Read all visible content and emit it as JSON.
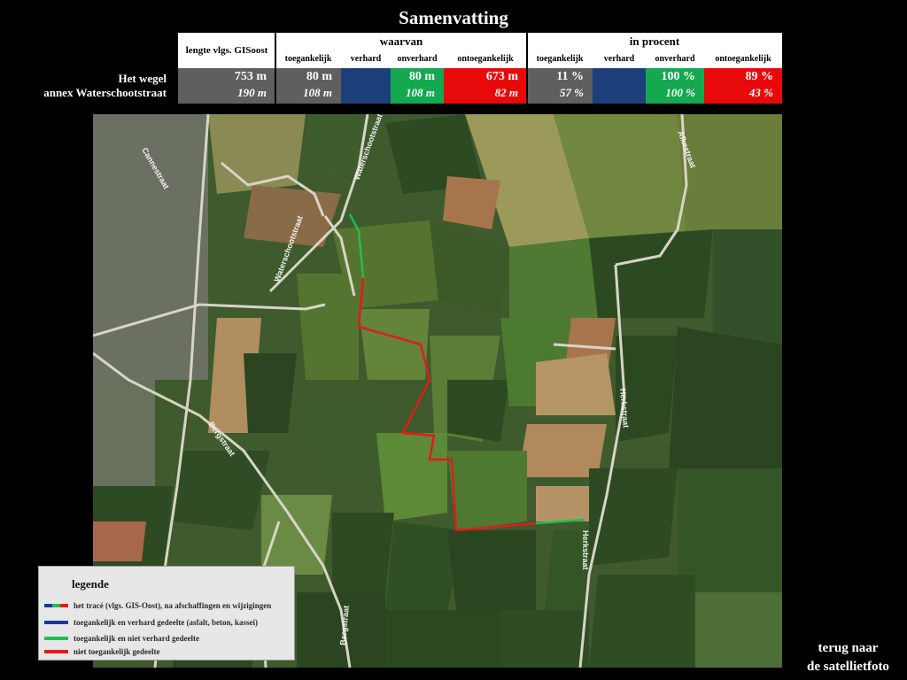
{
  "title": "Samenvatting",
  "road": {
    "line1": "Het wegel",
    "line2": "annex Waterschootstraat"
  },
  "table": {
    "length_header": "lengte vlgs. GISoost",
    "group_waarvan": "waarvan",
    "group_procent": "in procent",
    "sub_waarvan": [
      "toegankelijk",
      "verhard",
      "onverhard",
      "ontoegankelijk"
    ],
    "sub_procent": [
      "toegankelijk",
      "verhard",
      "onverhard",
      "ontoegankelijk"
    ],
    "row1": {
      "length": "753 m",
      "toegankelijk": "80 m",
      "verhard": "",
      "onverhard": "80 m",
      "ontoegankelijk": "673 m",
      "pct_toegankelijk": "11  %",
      "pct_verhard": "",
      "pct_onverhard": "100  %",
      "pct_ontoegankelijk": "89  %"
    },
    "row2": {
      "length": "190 m",
      "toegankelijk": "108 m",
      "verhard": "",
      "onverhard": "108 m",
      "ontoegankelijk": "82 m",
      "pct_toegankelijk": "57  %",
      "pct_verhard": "",
      "pct_onverhard": "100  %",
      "pct_ontoegankelijk": "43  %"
    }
  },
  "map": {
    "street_labels": [
      "Waterschootstraat",
      "Waterschootstraat",
      "Bergstraat",
      "Bergstraat",
      "Herkstraat",
      "Herkstraat",
      "Afkestraat",
      "Cannestraat"
    ]
  },
  "legend": {
    "title": "legende",
    "items": [
      "het tracé (vlgs. GIS-Oost), na afschaffingen en wijzigingen",
      "toegankelijk en verhard gedeelte (asfalt, beton, kassei)",
      "toegankelijk en niet verhard gedeelte",
      "niet toegankelijk gedeelte"
    ]
  },
  "back_link": {
    "line1": "terug naar",
    "line2": "de satellietfoto"
  },
  "colors": {
    "blue": "#1c3f7a",
    "green": "#14a850",
    "red": "#e80a0a",
    "gray": "#5f5f5f"
  }
}
